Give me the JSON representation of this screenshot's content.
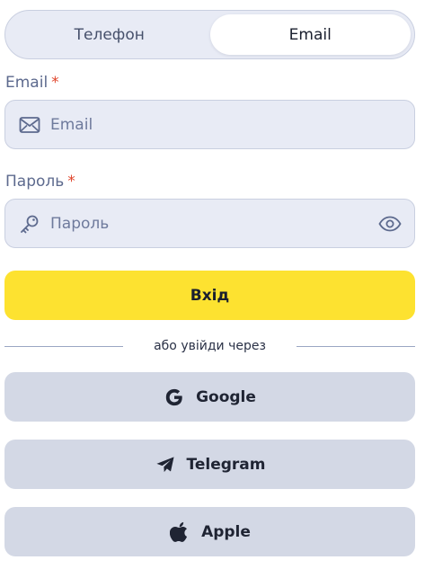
{
  "tabs": [
    {
      "label": "Телефон",
      "active": false
    },
    {
      "label": "Email",
      "active": true
    }
  ],
  "email": {
    "label": "Email",
    "required_mark": "*",
    "placeholder": "Email",
    "icon": "envelope-icon"
  },
  "password": {
    "label": "Пароль",
    "required_mark": "*",
    "placeholder": "Пароль",
    "icon": "key-icon",
    "toggle_icon": "eye-icon"
  },
  "login_button": {
    "label": "Вхід"
  },
  "divider_text": "або увійди через",
  "social": [
    {
      "label": "Google",
      "icon": "google-icon"
    },
    {
      "label": "Telegram",
      "icon": "telegram-icon"
    },
    {
      "label": "Apple",
      "icon": "apple-icon"
    }
  ],
  "colors": {
    "accent_yellow": "#fde230",
    "required_red": "#e0452b",
    "field_bg": "#e8ebf5",
    "social_bg": "#d3d8e5"
  }
}
